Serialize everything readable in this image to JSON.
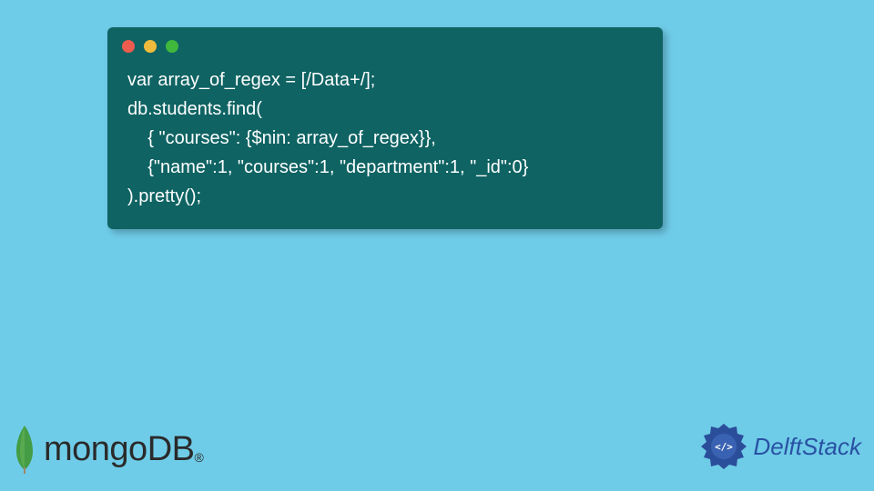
{
  "code": {
    "line1": "var array_of_regex = [/Data+/];",
    "line2": "db.students.find(",
    "line3": "    { \"courses\": {$nin: array_of_regex}},",
    "line4": "    {\"name\":1, \"courses\":1, \"department\":1, \"_id\":0}",
    "line5": ").pretty();"
  },
  "logos": {
    "mongodb": "mongoDB",
    "mongodb_reg": "®",
    "delftstack": "DelftStack"
  }
}
